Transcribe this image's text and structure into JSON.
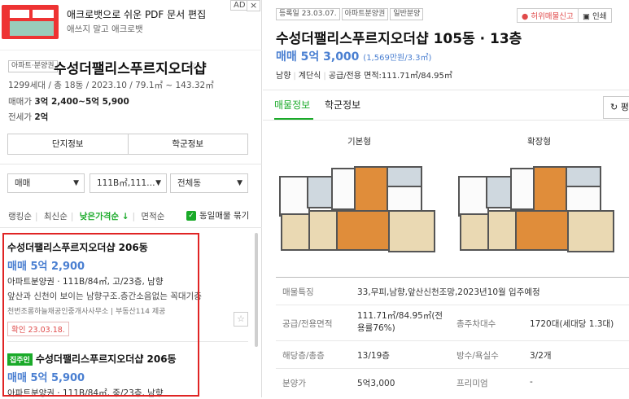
{
  "ad": {
    "title": "애크로뱃으로 쉬운 PDF 문서 편집",
    "subtitle": "애쓰지 말고 애크로뱃",
    "badge": "AD",
    "close": "×"
  },
  "complex": {
    "type_tag": "아파트·분양권",
    "name": "수성더팰리스푸르지오더샵",
    "star": "☆",
    "meta": "1299세대 / 총 18동 / 2023.10 / 79.1㎡ ~ 143.32㎡",
    "sale_label": "매매가",
    "sale_value": "3억 2,400~5억 5,900",
    "jeonse_label": "전세가",
    "jeonse_value": "2억",
    "buttons": [
      "단지정보",
      "학군정보"
    ]
  },
  "filters": {
    "trade": "매매",
    "area": "111B㎡,111…",
    "dong": "전체동"
  },
  "sort": {
    "items": [
      "랭킹순",
      "최신순",
      "낮은가격순 ↓",
      "면적순"
    ],
    "checkbox_label": "동일매물 묶기"
  },
  "listings": [
    {
      "badge": "",
      "title": "수성더팰리스푸르지오더샵 206동",
      "price": "매매 5억 2,900",
      "line": "아파트분양권 · 111B/84㎡, 고/23층, 남향",
      "desc": "앞산과 신천이 보이는 남향구조.층간소음없는 꼭대기층",
      "agent": "천번조롱하늘채공인중개사사무소  |  부동산114 제공",
      "confirm": "확인 23.03.18.",
      "star": "☆"
    },
    {
      "badge": "집주인",
      "title": "수성더팰리스푸르지오더샵 206동",
      "price": "매매 5억 5,900",
      "line": "아파트분양권 · 111B/84㎡, 중/23층, 남향"
    }
  ],
  "detail": {
    "tags": [
      "등록일 23.03.07.",
      "아파트분양권",
      "일반분양"
    ],
    "report": "허위매물신고",
    "print": "인쇄",
    "title": "수성더팰리스푸르지오더샵 105동 · 13층",
    "price": "매매 5억 3,000",
    "price_per": "(1,569만원/3.3㎡)",
    "info": [
      "남향",
      "계단식",
      "공급/전용 면적:111.71㎡/84.95㎡"
    ],
    "tabs": [
      "매물정보",
      "학군정보"
    ],
    "refresh": "↻ 평",
    "floorplans": [
      "기본형",
      "확장형"
    ],
    "table": [
      {
        "label": "매물특징",
        "value": "33,무피,남향,앞산신천조망,2023년10월 입주예정"
      },
      {
        "label": "공급/전용면적",
        "value": "111.71㎡/84.95㎡(전용률76%)",
        "label2": "총주차대수",
        "value2": "1720대(세대당 1.3대)"
      },
      {
        "label": "해당층/총층",
        "value": "13/19층",
        "label2": "방수/욕실수",
        "value2": "3/2개"
      },
      {
        "label": "분양가",
        "value": "5억3,000",
        "label2": "프리미엄",
        "value2": "-"
      }
    ]
  }
}
